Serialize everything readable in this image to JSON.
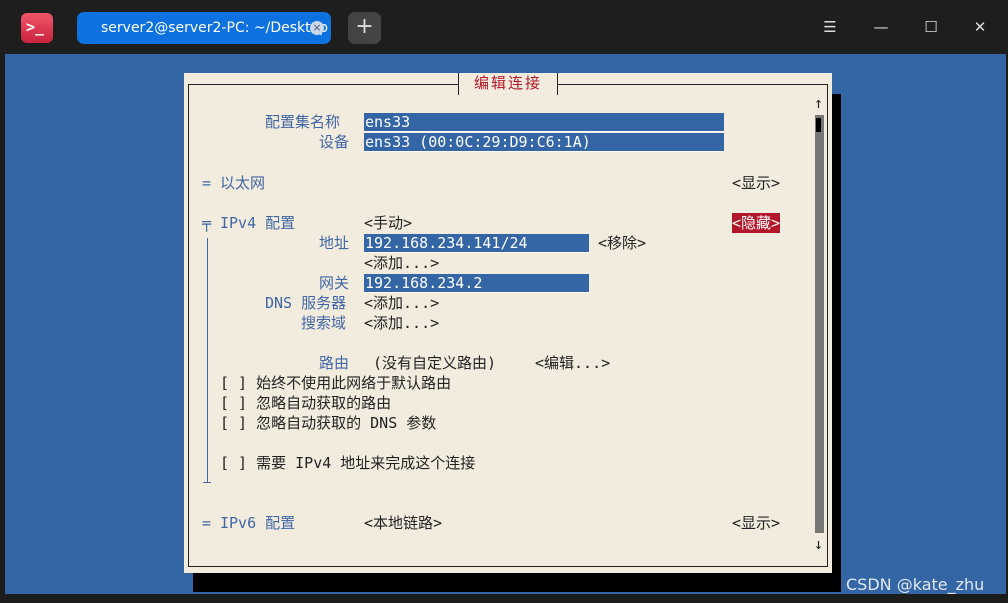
{
  "titlebar": {
    "app_icon_glyph": ">_",
    "tab_title": "server2@server2-PC: ~/Desktop",
    "tab_close": "×",
    "new_tab": "+",
    "menu": "☰",
    "minimize": "—",
    "maximize": "☐",
    "close": "✕"
  },
  "dialog": {
    "title": "编辑连接",
    "profile_name_label": "配置集名称",
    "profile_name_value": "ens33",
    "device_label": "设备",
    "device_value": "ens33 (00:0C:29:D9:C6:1A)",
    "ethernet": {
      "marker": "=",
      "label": "以太网",
      "toggle": "<显示>"
    },
    "ipv4": {
      "marker": "╤",
      "label": "IPv4 配置",
      "mode": "<手动>",
      "toggle": "<隐藏>",
      "address_label": "地址",
      "address_value": "192.168.234.141/24",
      "remove": "<移除>",
      "add_address": "<添加...>",
      "gateway_label": "网关",
      "gateway_value": "192.168.234.2",
      "dns_label": "DNS 服务器",
      "dns_add": "<添加...>",
      "search_label": "搜索域",
      "search_add": "<添加...>",
      "routing_label": "路由",
      "routing_value": "(没有自定义路由)",
      "routing_edit": "<编辑...>",
      "checkbox_never_default": "[ ] 始终不使用此网络于默认路由",
      "checkbox_ignore_routes": "[ ] 忽略自动获取的路由",
      "checkbox_ignore_dns": "[ ] 忽略自动获取的 DNS 参数",
      "checkbox_require_ipv4": "[ ] 需要 IPv4 地址来完成这个连接"
    },
    "ipv6": {
      "marker": "=",
      "label": "IPv6 配置",
      "mode": "<本地链路>",
      "toggle": "<显示>"
    },
    "scroll_up": "↑",
    "scroll_down": "↓"
  },
  "watermark": "CSDN @kate_zhu",
  "colors": {
    "terminal_bg": "#3465a4",
    "dialog_bg": "#f1ecdd",
    "accent_red": "#b3182a",
    "tab_blue": "#0d72e0"
  }
}
